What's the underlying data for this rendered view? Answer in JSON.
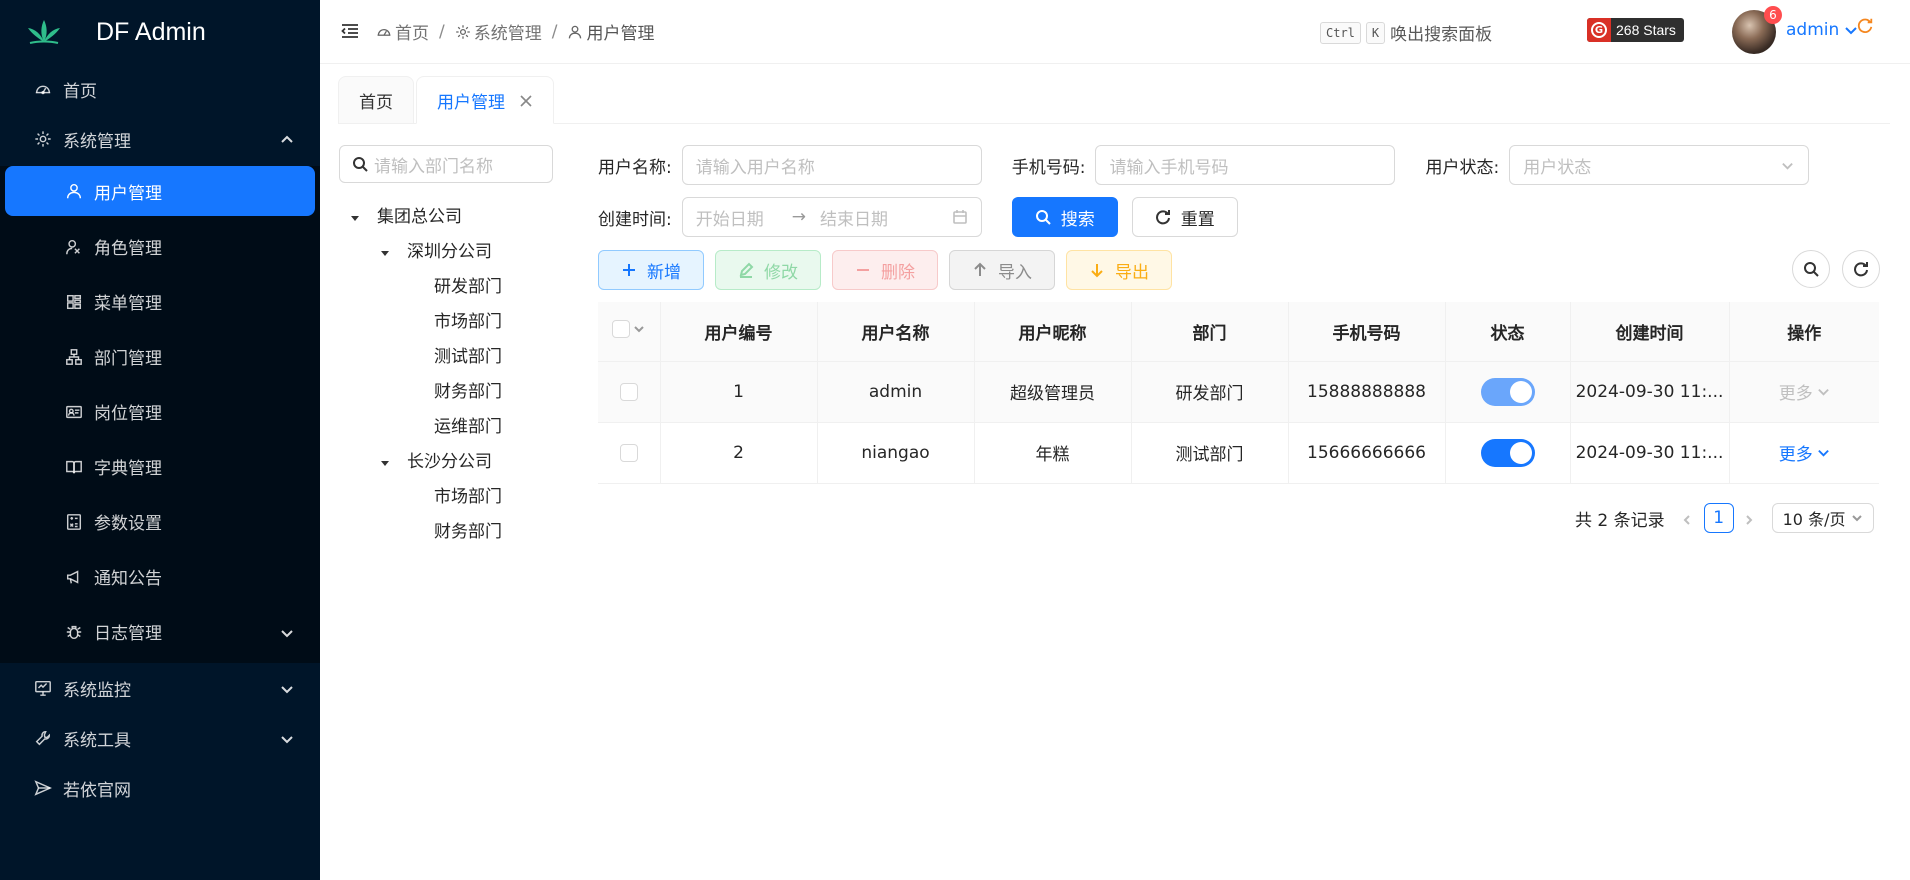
{
  "app": {
    "title": "DF Admin"
  },
  "colors": {
    "sidebar_bg": "#001529",
    "primary": "#1677ff"
  },
  "sidebar": {
    "items": [
      {
        "label": "首页",
        "icon": "dashboard-icon"
      },
      {
        "label": "系统管理",
        "icon": "gear-icon",
        "expanded": true,
        "children": [
          {
            "label": "用户管理",
            "icon": "user-icon",
            "active": true
          },
          {
            "label": "角色管理",
            "icon": "role-icon"
          },
          {
            "label": "菜单管理",
            "icon": "menu-icon"
          },
          {
            "label": "部门管理",
            "icon": "dept-icon"
          },
          {
            "label": "岗位管理",
            "icon": "idcard-icon"
          },
          {
            "label": "字典管理",
            "icon": "book-icon"
          },
          {
            "label": "参数设置",
            "icon": "calculator-icon"
          },
          {
            "label": "通知公告",
            "icon": "notification-icon"
          },
          {
            "label": "日志管理",
            "icon": "bug-icon"
          }
        ]
      },
      {
        "label": "系统监控",
        "icon": "monitor-icon"
      },
      {
        "label": "系统工具",
        "icon": "tool-icon"
      },
      {
        "label": "若依官网",
        "icon": "send-icon"
      }
    ]
  },
  "header": {
    "breadcrumb": [
      "首页",
      "系统管理",
      "用户管理"
    ],
    "kbd_ctrl": "Ctrl",
    "kbd_k": "K",
    "search_hint": "唤出搜索面板",
    "stars": "268 Stars",
    "badge": "6",
    "user": "admin"
  },
  "tabs": [
    {
      "label": "首页"
    },
    {
      "label": "用户管理",
      "active": true
    }
  ],
  "dept": {
    "search_placeholder": "请输入部门名称",
    "tree": {
      "root": "集团总公司",
      "branch1": "深圳分公司",
      "branch1_children": [
        "研发部门",
        "市场部门",
        "测试部门",
        "财务部门",
        "运维部门"
      ],
      "branch2": "长沙分公司",
      "branch2_children": [
        "市场部门",
        "财务部门"
      ]
    }
  },
  "query": {
    "username_label": "用户名称:",
    "username_placeholder": "请输入用户名称",
    "phone_label": "手机号码:",
    "phone_placeholder": "请输入手机号码",
    "status_label": "用户状态:",
    "status_placeholder": "用户状态",
    "time_label": "创建时间:",
    "start_placeholder": "开始日期",
    "end_placeholder": "结束日期",
    "search_btn": "搜索",
    "reset_btn": "重置"
  },
  "toolbar": {
    "add": "新增",
    "edit": "修改",
    "delete": "删除",
    "import": "导入",
    "export": "导出"
  },
  "table": {
    "columns": [
      "用户编号",
      "用户名称",
      "用户昵称",
      "部门",
      "手机号码",
      "状态",
      "创建时间",
      "操作"
    ],
    "rows": [
      {
        "id": "1",
        "username": "admin",
        "nickname": "超级管理员",
        "dept": "研发部门",
        "phone": "15888888888",
        "status_on": true,
        "created": "2024-09-30 11:...",
        "action": "更多"
      },
      {
        "id": "2",
        "username": "niangao",
        "nickname": "年糕",
        "dept": "测试部门",
        "phone": "15666666666",
        "status_on": true,
        "created": "2024-09-30 11:...",
        "action": "更多"
      }
    ]
  },
  "pagination": {
    "total": "共 2 条记录",
    "page": "1",
    "page_size": "10 条/页"
  }
}
